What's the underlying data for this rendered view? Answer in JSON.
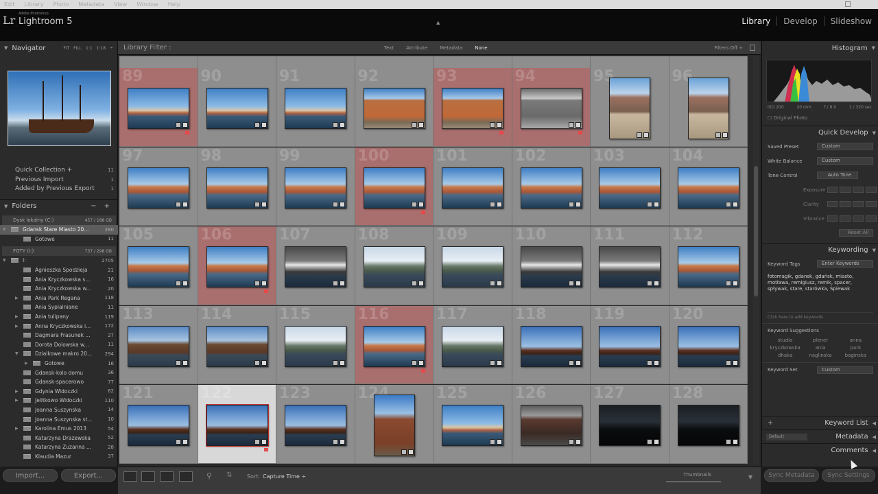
{
  "menubar": {
    "items": [
      "Edit",
      "Library",
      "Photo",
      "Metadata",
      "View",
      "Window",
      "Help"
    ]
  },
  "identity": {
    "small": "Adobe Photoshop",
    "app_name": "Lightroom 5",
    "modules": [
      "Library",
      "Develop",
      "Slideshow"
    ]
  },
  "navigator": {
    "title": "Navigator",
    "options": [
      "FIT",
      "FILL",
      "1:1",
      "1:18 ÷"
    ]
  },
  "catalog": [
    {
      "label": "Quick Collection +",
      "count": "11"
    },
    {
      "label": "Previous Import",
      "count": "1"
    },
    {
      "label": "Added by Previous Export",
      "count": "1"
    }
  ],
  "folders": {
    "title": "Folders",
    "volumes": [
      {
        "name": "Dysk lokalny (C:)",
        "space": "457 / 188 GB"
      },
      {
        "name": "FOTY (I:)",
        "space": "737 / 298 GB"
      }
    ],
    "vol1_items": [
      {
        "name": "Gdansk Stare Miasto 20...",
        "count": "280",
        "selected": true,
        "twisty": "▼",
        "indent": 16
      },
      {
        "name": "Gotowe",
        "count": "11",
        "twisty": "",
        "indent": 34
      }
    ],
    "vol2_items": [
      {
        "name": "I:",
        "count": "2705",
        "twisty": "▼",
        "indent": 16
      },
      {
        "name": "Agnieszka Spodzieja",
        "count": "21",
        "twisty": "",
        "indent": 34
      },
      {
        "name": "Ania Kryczkowska s...",
        "count": "16",
        "twisty": "",
        "indent": 34
      },
      {
        "name": "Ania Kryczkowska w...",
        "count": "20",
        "twisty": "",
        "indent": 34
      },
      {
        "name": "Ania Park Regana",
        "count": "118",
        "twisty": "▶",
        "indent": 34
      },
      {
        "name": "Ania Sypialniane",
        "count": "11",
        "twisty": "",
        "indent": 34
      },
      {
        "name": "Ania tulipany",
        "count": "119",
        "twisty": "▶",
        "indent": 34
      },
      {
        "name": "Anna Kryczkowska i...",
        "count": "172",
        "twisty": "▶",
        "indent": 34
      },
      {
        "name": "Dagmara Frasunek ...",
        "count": "27",
        "twisty": "",
        "indent": 34
      },
      {
        "name": "Dorota Dolowska w...",
        "count": "11",
        "twisty": "",
        "indent": 34
      },
      {
        "name": "Dzialkowe makro 20...",
        "count": "294",
        "twisty": "▼",
        "indent": 34
      },
      {
        "name": "Gotowe",
        "count": "16",
        "twisty": "▶",
        "indent": 48
      },
      {
        "name": "Gdansk-kolo domu",
        "count": "36",
        "twisty": "",
        "indent": 34
      },
      {
        "name": "Gdansk-spacerowo",
        "count": "77",
        "twisty": "",
        "indent": 34
      },
      {
        "name": "Gdynia Widoczki",
        "count": "62",
        "twisty": "▶",
        "indent": 34
      },
      {
        "name": "Jelitkowo Widoczki",
        "count": "110",
        "twisty": "▶",
        "indent": 34
      },
      {
        "name": "Joanna Suszynska",
        "count": "14",
        "twisty": "",
        "indent": 34
      },
      {
        "name": "Joanna Suszynska st...",
        "count": "10",
        "twisty": "",
        "indent": 34
      },
      {
        "name": "Karolina Emus 2013",
        "count": "54",
        "twisty": "▶",
        "indent": 34
      },
      {
        "name": "Katarzyna Drazewska",
        "count": "52",
        "twisty": "",
        "indent": 34
      },
      {
        "name": "Katarzyna Zuzanna ...",
        "count": "28",
        "twisty": "",
        "indent": 34
      },
      {
        "name": "Klaudia Mazur",
        "count": "37",
        "twisty": "",
        "indent": 34
      }
    ]
  },
  "left_buttons": {
    "import": "Import...",
    "export": "Export..."
  },
  "filter": {
    "title": "Library Filter :",
    "options": [
      "Text",
      "Attribute",
      "Metadata",
      "None"
    ],
    "active": "None",
    "filters_off": "Filters Off ÷"
  },
  "grid": {
    "partial_row": [
      true,
      false,
      false,
      false,
      false,
      false,
      false,
      false
    ],
    "rows": [
      [
        {
          "n": "89",
          "bg": "red",
          "o": "l",
          "flag": true,
          "scene": "harbor"
        },
        {
          "n": "90",
          "bg": "gray",
          "o": "l",
          "scene": "harbor"
        },
        {
          "n": "91",
          "bg": "gray",
          "o": "l",
          "scene": "harbor"
        },
        {
          "n": "92",
          "bg": "gray",
          "o": "l",
          "scene": "hall"
        },
        {
          "n": "93",
          "bg": "red",
          "o": "l",
          "flag": true,
          "scene": "hall"
        },
        {
          "n": "94",
          "bg": "red",
          "o": "l",
          "flag": true,
          "scene": "hallbw"
        },
        {
          "n": "95",
          "bg": "gray",
          "o": "p",
          "scene": "square"
        },
        {
          "n": "96",
          "bg": "gray",
          "o": "p",
          "scene": "square"
        }
      ],
      [
        {
          "n": "97",
          "bg": "gray",
          "o": "l",
          "scene": "river"
        },
        {
          "n": "98",
          "bg": "gray",
          "o": "l",
          "scene": "river"
        },
        {
          "n": "99",
          "bg": "gray",
          "o": "l",
          "scene": "river"
        },
        {
          "n": "100",
          "bg": "red",
          "o": "l",
          "flag": true,
          "scene": "river"
        },
        {
          "n": "101",
          "bg": "gray",
          "o": "l",
          "scene": "river"
        },
        {
          "n": "102",
          "bg": "gray",
          "o": "l",
          "scene": "river"
        },
        {
          "n": "103",
          "bg": "gray",
          "o": "l",
          "scene": "river"
        },
        {
          "n": "104",
          "bg": "gray",
          "o": "l",
          "scene": "river"
        }
      ],
      [
        {
          "n": "105",
          "bg": "gray",
          "o": "l",
          "scene": "river"
        },
        {
          "n": "106",
          "bg": "red",
          "o": "l",
          "flag": true,
          "scene": "river"
        },
        {
          "n": "107",
          "bg": "gray",
          "o": "l",
          "scene": "boat"
        },
        {
          "n": "108",
          "bg": "gray",
          "o": "l",
          "scene": "bridge"
        },
        {
          "n": "109",
          "bg": "gray",
          "o": "l",
          "scene": "bridge"
        },
        {
          "n": "110",
          "bg": "gray",
          "o": "l",
          "scene": "boat"
        },
        {
          "n": "111",
          "bg": "gray",
          "o": "l",
          "scene": "boat"
        },
        {
          "n": "112",
          "bg": "gray",
          "o": "l",
          "scene": "river"
        }
      ],
      [
        {
          "n": "113",
          "bg": "gray",
          "o": "l",
          "scene": "warehouse"
        },
        {
          "n": "114",
          "bg": "gray",
          "o": "l",
          "scene": "warehouse"
        },
        {
          "n": "115",
          "bg": "gray",
          "o": "l",
          "scene": "bridge"
        },
        {
          "n": "116",
          "bg": "red",
          "o": "l",
          "flag": true,
          "scene": "river"
        },
        {
          "n": "117",
          "bg": "gray",
          "o": "l",
          "scene": "bridge"
        },
        {
          "n": "118",
          "bg": "gray",
          "o": "l",
          "scene": "ship"
        },
        {
          "n": "119",
          "bg": "gray",
          "o": "l",
          "scene": "ship"
        },
        {
          "n": "120",
          "bg": "gray",
          "o": "l",
          "scene": "ship"
        }
      ],
      [
        {
          "n": "121",
          "bg": "gray",
          "o": "l",
          "scene": "ship"
        },
        {
          "n": "122",
          "bg": "white",
          "o": "l",
          "flag": true,
          "selected": true,
          "scene": "ship"
        },
        {
          "n": "123",
          "bg": "gray",
          "o": "l",
          "scene": "ship"
        },
        {
          "n": "124",
          "bg": "gray",
          "o": "p",
          "scene": "tower"
        },
        {
          "n": "125",
          "bg": "gray",
          "o": "l",
          "scene": "harbor"
        },
        {
          "n": "126",
          "bg": "gray",
          "o": "l",
          "scene": "street"
        },
        {
          "n": "127",
          "bg": "gray",
          "o": "l",
          "scene": "dark"
        },
        {
          "n": "128",
          "bg": "gray",
          "o": "l",
          "scene": "dark"
        }
      ]
    ]
  },
  "toolbar": {
    "sort_label": "Sort:",
    "sort_value": "Capture Time ÷",
    "thumbnails": "Thumbnails"
  },
  "histogram": {
    "title": "Histogram",
    "iso": "ISO 200",
    "focal": "20 mm",
    "aperture": "f / 8.0",
    "shutter": "1 / 320 sec",
    "original_photo": "Original Photo"
  },
  "quick_develop": {
    "title": "Quick Develop",
    "saved_preset_label": "Saved Preset",
    "saved_preset_value": "Custom",
    "white_balance_label": "White Balance",
    "white_balance_value": "Custom",
    "tone_control_label": "Tone Control",
    "auto_tone": "Auto Tone",
    "exposure": "Exposure",
    "clarity": "Clarity",
    "vibrance": "Vibrance",
    "reset_all": "Reset All"
  },
  "keywording": {
    "title": "Keywording",
    "tags_label": "Keyword Tags",
    "tags_mode": "Enter Keywords",
    "keywords": "fotomagik, gdansk, gdańsk, miasto, motława, remigiusz, remik, spacer, spływak, stare, starówka, Śpiewak",
    "hint": "Click here to add keywords",
    "suggestions_label": "Keyword Suggestions",
    "suggestions": [
      "studio",
      "plener",
      "anna",
      "kryczkowska",
      "ania",
      "park",
      "dhaka",
      "naglinska",
      "baginska"
    ],
    "set_label": "Keyword Set",
    "set_value": "Custom"
  },
  "keyword_list": {
    "title": "Keyword List"
  },
  "metadata": {
    "title": "Metadata",
    "preset": "Default"
  },
  "comments": {
    "title": "Comments"
  },
  "right_buttons": {
    "sync_metadata": "Sync Metadata",
    "sync_settings": "Sync Settings"
  }
}
